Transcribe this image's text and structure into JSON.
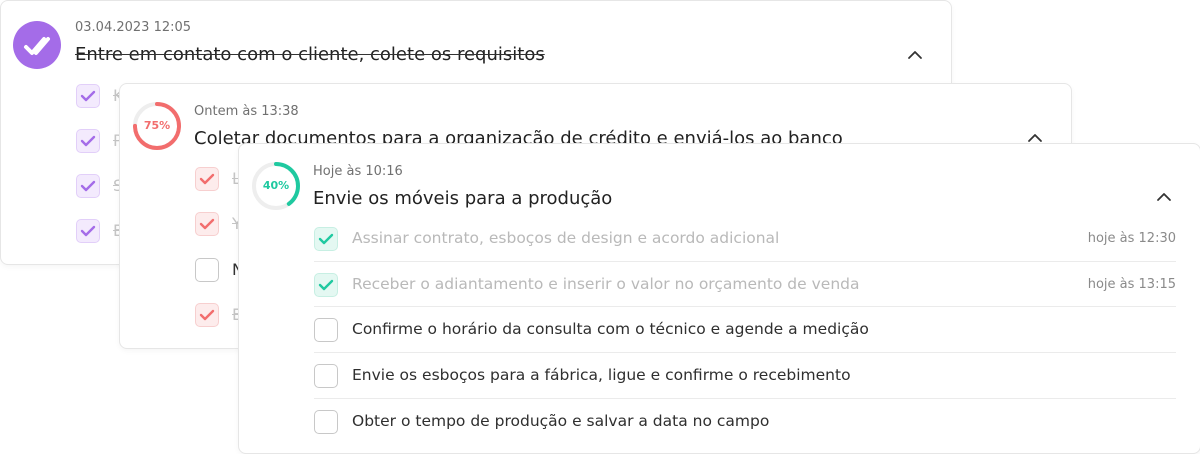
{
  "colors": {
    "purple": "#a46ce8",
    "red": "#f26d6d",
    "teal": "#1fc9a0"
  },
  "card1": {
    "timestamp": "03.04.2023 12:05",
    "title": "Entre em contato com o cliente, colete os requisitos",
    "avatar_icon": "double-check-icon",
    "fragments": [
      "K",
      "P",
      "S",
      "E"
    ]
  },
  "card2": {
    "timestamp": "Ontem às 13:38",
    "title": "Coletar documentos para a organização de crédito e enviá-los ao banco",
    "progress_percent": 75,
    "progress_label": "75%",
    "fragments": [
      "L",
      "Y",
      "N",
      "E"
    ],
    "fragment_checked": [
      true,
      true,
      false,
      true
    ]
  },
  "card3": {
    "timestamp": "Hoje às 10:16",
    "title": "Envie os móveis para a produção",
    "progress_percent": 40,
    "progress_label": "40%",
    "tasks": [
      {
        "label": "Assinar contrato, esboços de design e acordo adicional",
        "done": true,
        "time": "hoje às 12:30"
      },
      {
        "label": "Receber o adiantamento e inserir o valor no orçamento de venda",
        "done": true,
        "time": "hoje às 13:15"
      },
      {
        "label": "Confirme o horário da consulta com o técnico e agende a medição",
        "done": false,
        "time": ""
      },
      {
        "label": "Envie os esboços para a fábrica, ligue e confirme o recebimento",
        "done": false,
        "time": ""
      },
      {
        "label": "Obter o tempo de produção e salvar a data no campo",
        "done": false,
        "time": ""
      }
    ]
  }
}
